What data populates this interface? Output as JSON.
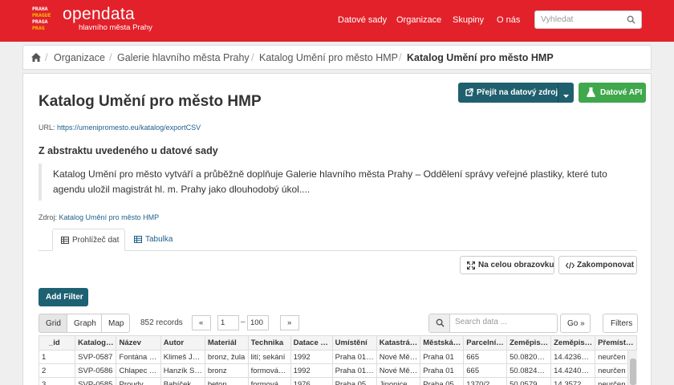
{
  "brand": {
    "logo_lines": [
      "PRAHA",
      "PRAGUE",
      "PRAGA",
      "PRAG"
    ],
    "title": "opendata",
    "subtitle": "hlavního města Prahy"
  },
  "nav": {
    "items": [
      "Datové sady",
      "Organizace",
      "Skupiny",
      "O nás"
    ],
    "search_placeholder": "Vyhledat"
  },
  "breadcrumb": [
    "Organizace",
    "Galerie hlavního města Prahy",
    "Katalog Umění pro město HMP",
    "Katalog Umění pro město HMP"
  ],
  "resource": {
    "title": "Katalog Umění pro město HMP",
    "url_label": "URL:",
    "url": "https://umenipromesto.eu/katalog/exportCSV",
    "goto_label": "Přejít na datový zdroj",
    "api_label": "Datové API",
    "abstract_heading": "Z abstraktu uvedeného u datové sady",
    "abstract_text": "Katalog Umění pro město vytváří a průběžně doplňuje Galerie hlavního města Prahy – Oddělení správy veřejné plastiky, které tuto agendu uložil magistrát hl. m. Prahy jako dlouhodobý úkol....",
    "source_label": "Zdroj:",
    "source_link": "Katalog Umění pro město HMP"
  },
  "tabs": [
    "Prohlížeč dat",
    "Tabulka"
  ],
  "actions": {
    "fullscreen": "Na celou obrazovku",
    "embed": "Zakomponovat"
  },
  "explorer": {
    "add_filter": "Add Filter",
    "views": [
      "Grid",
      "Graph",
      "Map"
    ],
    "records": "852 records",
    "pager_prev": "«",
    "pager_from": "1",
    "pager_dash": "–",
    "pager_to": "100",
    "pager_next": "»",
    "search_placeholder": "Search data ...",
    "go": "Go »",
    "filters": "Filters"
  },
  "table": {
    "columns": [
      "_id",
      "Katalog…",
      "Název",
      "Autor",
      "Materiál",
      "Technika",
      "Datace …",
      "Umístění",
      "Katastrá…",
      "Městská…",
      "Parcelní…",
      "Zeměpis…",
      "Zeměpis…",
      "Přemíst…"
    ],
    "rows": [
      [
        "1",
        "SVP-0587",
        "Fontána …",
        "Klimeš J…",
        "bronz, žula",
        "lití; sekání",
        "1992",
        "Praha 01…",
        "Nové Mě…",
        "Praha 01",
        "665",
        "50.0820…",
        "14.4236…",
        "neurčen"
      ],
      [
        "2",
        "SVP-0586",
        "Chlapec …",
        "Hanzík S…",
        "bronz",
        "formová…",
        "1992",
        "Praha 01…",
        "Nové Mě…",
        "Praha 01",
        "665",
        "50.0824…",
        "14.4240…",
        "neurčen"
      ],
      [
        "3",
        "SVP-0585",
        "Proudy",
        "Babíček …",
        "beton",
        "formová…",
        "1976",
        "Praha 05…",
        "Jinonice",
        "Praha 05",
        "1370/2",
        "50.0579…",
        "14.3572…",
        "neurčen"
      ]
    ]
  }
}
